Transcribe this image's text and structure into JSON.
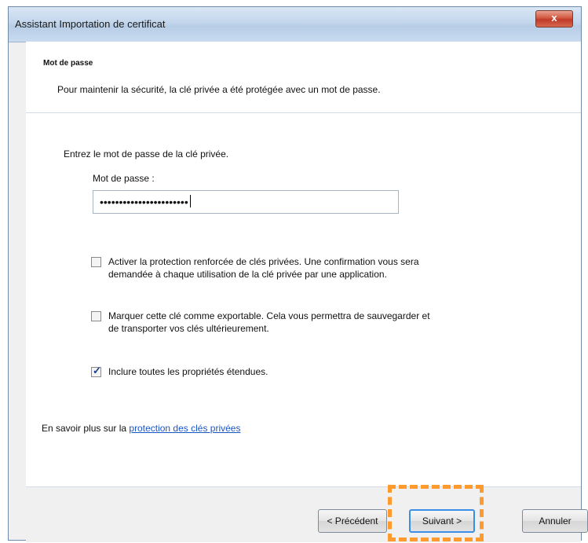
{
  "window": {
    "title": "Assistant Importation de certificat",
    "close_glyph": "x"
  },
  "header": {
    "title": "Mot de passe",
    "description": "Pour maintenir la sécurité, la clé privée a été protégée avec un mot de passe."
  },
  "body": {
    "prompt": "Entrez le mot de passe de la clé privée.",
    "password_label": "Mot de passe :",
    "password_value": "•••••••••••••••••••••••",
    "checkboxes": [
      {
        "line1": "Activer la protection renforcée de clés privées. Une confirmation vous sera",
        "line2": "demandée à chaque utilisation de la clé privée par une application.",
        "checked": false
      },
      {
        "line1": "Marquer cette clé comme exportable. Cela vous permettra de sauvegarder et",
        "line2": "de transporter vos clés ultérieurement.",
        "checked": false
      },
      {
        "line1": "Inclure toutes les propriétés étendues.",
        "line2": "",
        "checked": true
      }
    ],
    "learn_more_prefix": "En savoir plus sur la",
    "learn_more_link": "protection des clés privées"
  },
  "footer": {
    "prev_label": "< Précédent",
    "next_label": "Suivant >",
    "cancel_label": "Annuler"
  },
  "colors": {
    "highlight": "#ff9a2e",
    "link": "#1a55c4",
    "checkmark": "#1a3f8f"
  }
}
